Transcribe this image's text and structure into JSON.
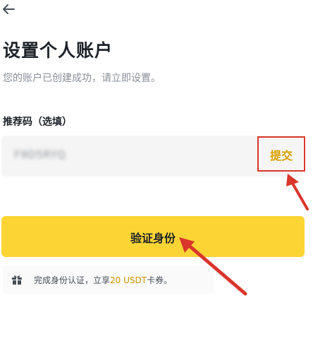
{
  "header": {
    "back_icon": "back-arrow-icon"
  },
  "page": {
    "title": "设置个人账户",
    "subtitle": "您的账户已创建成功，请立即设置。"
  },
  "referral": {
    "label": "推荐码（选填）",
    "value": "F9D5RYQ",
    "submit_label": "提交"
  },
  "verify_button": {
    "label": "验证身份"
  },
  "reward": {
    "icon": "gift-icon",
    "text_before": "完成身份认证，立享",
    "highlight": "20 USDT",
    "text_after": "卡券。"
  },
  "colors": {
    "accent_yellow": "#FCD535",
    "highlight_text": "#C99400",
    "annotation_red": "#D9362C"
  }
}
